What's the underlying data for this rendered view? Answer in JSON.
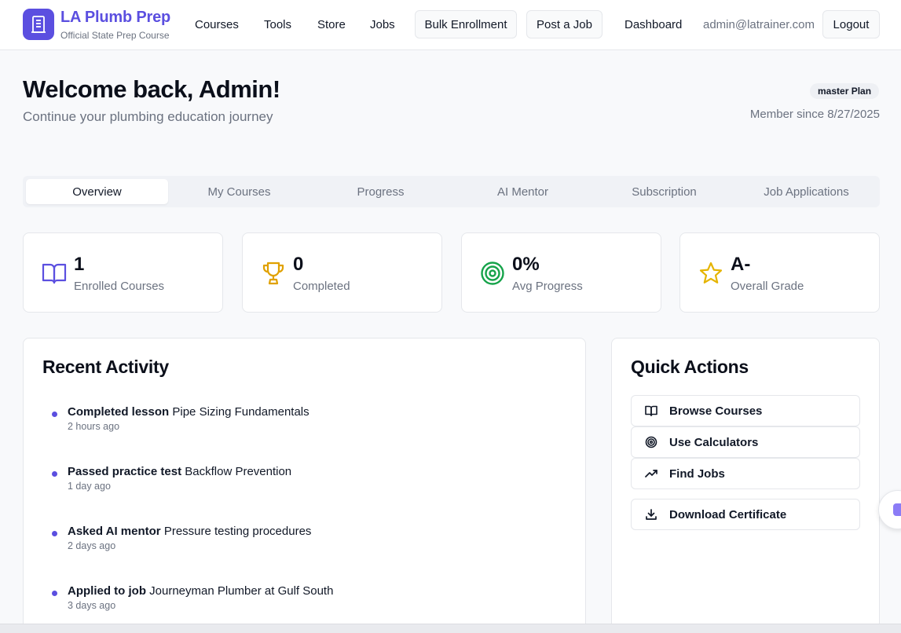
{
  "brand": {
    "title": "LA Plumb Prep",
    "subtitle": "Official State Prep Course",
    "color": "#5b4fe0"
  },
  "nav": {
    "links": [
      "Courses",
      "Tools",
      "Store",
      "Jobs"
    ],
    "bulk_enrollment": "Bulk Enrollment",
    "post_job": "Post a Job",
    "dashboard": "Dashboard",
    "email": "admin@latrainer.com",
    "logout": "Logout"
  },
  "welcome": {
    "title": "Welcome back, Admin!",
    "subtitle": "Continue your plumbing education journey",
    "plan_badge": "master Plan",
    "member_since": "Member since 8/27/2025"
  },
  "tabs": [
    "Overview",
    "My Courses",
    "Progress",
    "AI Mentor",
    "Subscription",
    "Job Applications"
  ],
  "active_tab": "Overview",
  "stats": [
    {
      "value": "1",
      "label": "Enrolled Courses",
      "icon": "book-open-icon",
      "color": "#5b4fe0"
    },
    {
      "value": "0",
      "label": "Completed",
      "icon": "trophy-icon",
      "color": "#e0a100"
    },
    {
      "value": "0%",
      "label": "Avg Progress",
      "icon": "target-icon",
      "color": "#16a34a"
    },
    {
      "value": "A-",
      "label": "Overall Grade",
      "icon": "star-icon",
      "color": "#e5b400"
    }
  ],
  "recent_activity": {
    "title": "Recent Activity",
    "items": [
      {
        "action": "Completed lesson",
        "subject": "Pipe Sizing Fundamentals",
        "time": "2 hours ago"
      },
      {
        "action": "Passed practice test",
        "subject": "Backflow Prevention",
        "time": "1 day ago"
      },
      {
        "action": "Asked AI mentor",
        "subject": "Pressure testing procedures",
        "time": "2 days ago"
      },
      {
        "action": "Applied to job",
        "subject": "Journeyman Plumber at Gulf South",
        "time": "3 days ago"
      }
    ]
  },
  "quick_actions": {
    "title": "Quick Actions",
    "items": [
      {
        "label": "Browse Courses",
        "icon": "book-open-icon"
      },
      {
        "label": "Use Calculators",
        "icon": "target-icon"
      },
      {
        "label": "Find Jobs",
        "icon": "trending-up-icon"
      },
      {
        "label": "Download Certificate",
        "icon": "download-icon"
      }
    ]
  }
}
